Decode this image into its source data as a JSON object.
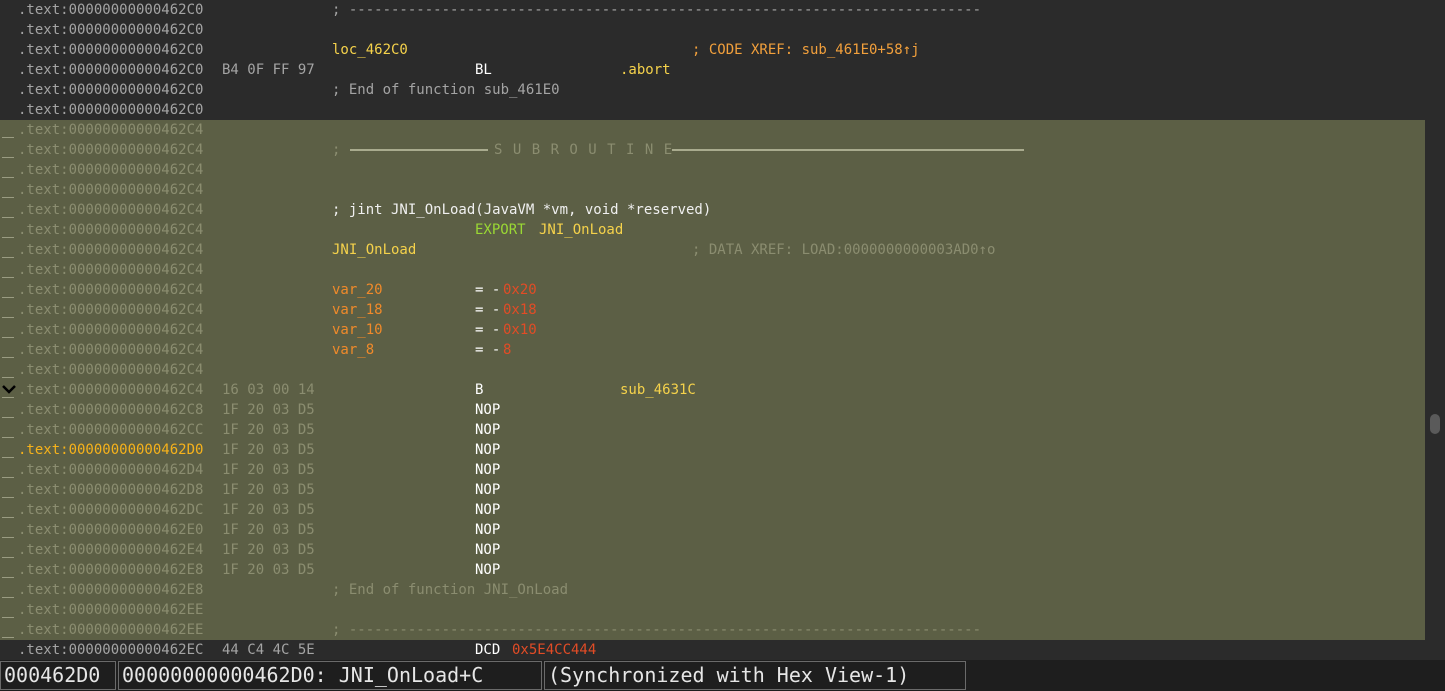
{
  "listing": {
    "rows": [
      {
        "addr": ".text:00000000000462C0",
        "full": "; ---------------------------------------------------------------------------",
        "full_cls": "c-gray"
      },
      {
        "addr": ".text:00000000000462C0"
      },
      {
        "addr": ".text:00000000000462C0",
        "label": "loc_462C0",
        "label_cls": "c-label",
        "cmt": "; CODE XREF: sub_461E0+58↑j",
        "cmt_cls": "c-xref"
      },
      {
        "addr": ".text:00000000000462C0",
        "bytes": "B4 0F FF 97",
        "mn": "BL",
        "op": ".abort",
        "op_cls": "c-sym"
      },
      {
        "addr": ".text:00000000000462C0",
        "full": "; End of function sub_461E0",
        "full_cls": "c-gray"
      },
      {
        "addr": ".text:00000000000462C0"
      },
      {
        "addr": ".text:00000000000462C4",
        "band": true
      },
      {
        "addr": ".text:00000000000462C4",
        "band": true,
        "sep": true,
        "full": "; ",
        "full_cls": "c-faint",
        "sep_text": "S U B R O U T I N E"
      },
      {
        "addr": ".text:00000000000462C4",
        "band": true
      },
      {
        "addr": ".text:00000000000462C4",
        "band": true
      },
      {
        "addr": ".text:00000000000462C4",
        "band": true,
        "full": "; jint JNI_OnLoad(JavaVM *vm, void *reserved)",
        "full_cls": "c-white"
      },
      {
        "addr": ".text:00000000000462C4",
        "band": true,
        "mn": "EXPORT",
        "mn_cls": "c-export",
        "op_inline": "JNI_OnLoad",
        "op_inline_cls": "c-sym"
      },
      {
        "addr": ".text:00000000000462C4",
        "band": true,
        "label": "JNI_OnLoad",
        "label_cls": "c-label",
        "cmt": "; DATA XREF: LOAD:0000000000003AD0↑o",
        "cmt_cls": "c-faint"
      },
      {
        "addr": ".text:00000000000462C4",
        "band": true
      },
      {
        "addr": ".text:00000000000462C4",
        "band": true,
        "label": "var_20",
        "label_cls": "c-var",
        "mn": "= -",
        "num": "0x20"
      },
      {
        "addr": ".text:00000000000462C4",
        "band": true,
        "label": "var_18",
        "label_cls": "c-var",
        "mn": "= -",
        "num": "0x18"
      },
      {
        "addr": ".text:00000000000462C4",
        "band": true,
        "label": "var_10",
        "label_cls": "c-var",
        "mn": "= -",
        "num": "0x10"
      },
      {
        "addr": ".text:00000000000462C4",
        "band": true,
        "label": "var_8",
        "label_cls": "c-var",
        "mn": "= -",
        "num": "8"
      },
      {
        "addr": ".text:00000000000462C4",
        "band": true
      },
      {
        "addr": ".text:00000000000462C4",
        "band": true,
        "bytes": "16 03 00 14",
        "mn": "B",
        "op": "sub_4631C",
        "op_cls": "c-sym",
        "fold": true
      },
      {
        "addr": ".text:00000000000462C8",
        "band": true,
        "bytes": "1F 20 03 D5",
        "mn": "NOP"
      },
      {
        "addr": ".text:00000000000462CC",
        "band": true,
        "bytes": "1F 20 03 D5",
        "mn": "NOP"
      },
      {
        "addr": ".text:00000000000462D0",
        "band": true,
        "current": true,
        "bytes": "1F 20 03 D5",
        "mn": "NOP"
      },
      {
        "addr": ".text:00000000000462D4",
        "band": true,
        "bytes": "1F 20 03 D5",
        "mn": "NOP"
      },
      {
        "addr": ".text:00000000000462D8",
        "band": true,
        "bytes": "1F 20 03 D5",
        "mn": "NOP"
      },
      {
        "addr": ".text:00000000000462DC",
        "band": true,
        "bytes": "1F 20 03 D5",
        "mn": "NOP"
      },
      {
        "addr": ".text:00000000000462E0",
        "band": true,
        "bytes": "1F 20 03 D5",
        "mn": "NOP"
      },
      {
        "addr": ".text:00000000000462E4",
        "band": true,
        "bytes": "1F 20 03 D5",
        "mn": "NOP"
      },
      {
        "addr": ".text:00000000000462E8",
        "band": true,
        "bytes": "1F 20 03 D5",
        "mn": "NOP"
      },
      {
        "addr": ".text:00000000000462E8",
        "band": true,
        "full": "; End of function JNI_OnLoad",
        "full_cls": "c-faint"
      },
      {
        "addr": ".text:00000000000462EE",
        "band": true
      },
      {
        "addr": ".text:00000000000462EE",
        "band": true,
        "full": "; ---------------------------------------------------------------------------",
        "full_cls": "c-faint"
      },
      {
        "addr": ".text:00000000000462EC",
        "bytes": "44 C4 4C 5E",
        "mn": "DCD",
        "num_op": "0x5E4CC444"
      }
    ]
  },
  "status": {
    "offset": "000462D0",
    "location": "00000000000462D0: JNI_OnLoad+C",
    "sync": "(Synchronized with Hex View-1)"
  },
  "colors": {
    "background": "#2b2b2b",
    "highlight_band": "#5c5f45",
    "current_address": "#f6b21b"
  },
  "icons": [
    "collapse-chevron-icon"
  ]
}
